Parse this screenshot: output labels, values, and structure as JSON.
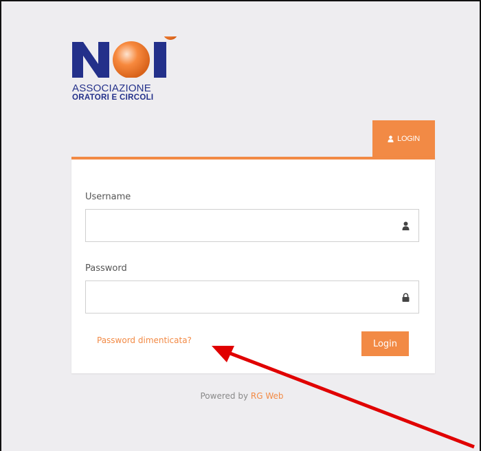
{
  "logo": {
    "letters": "NOI",
    "line1": "ASSOCIAZIONE",
    "line2": "ORATORI E CIRCOLI",
    "colors": {
      "navy": "#23308a",
      "orange": "#f7893e"
    }
  },
  "tab": {
    "label": "LOGIN",
    "icon": "user-icon"
  },
  "form": {
    "username_label": "Username",
    "username_value": "",
    "username_icon": "user-icon",
    "password_label": "Password",
    "password_value": "",
    "password_icon": "lock-icon",
    "forgot_link": "Password dimenticata?",
    "login_button": "Login"
  },
  "footer": {
    "prefix": "Powered by ",
    "brand": "RG Web"
  },
  "colors": {
    "accent": "#f28a45",
    "background": "#eeedf0",
    "arrow": "#e00000"
  }
}
